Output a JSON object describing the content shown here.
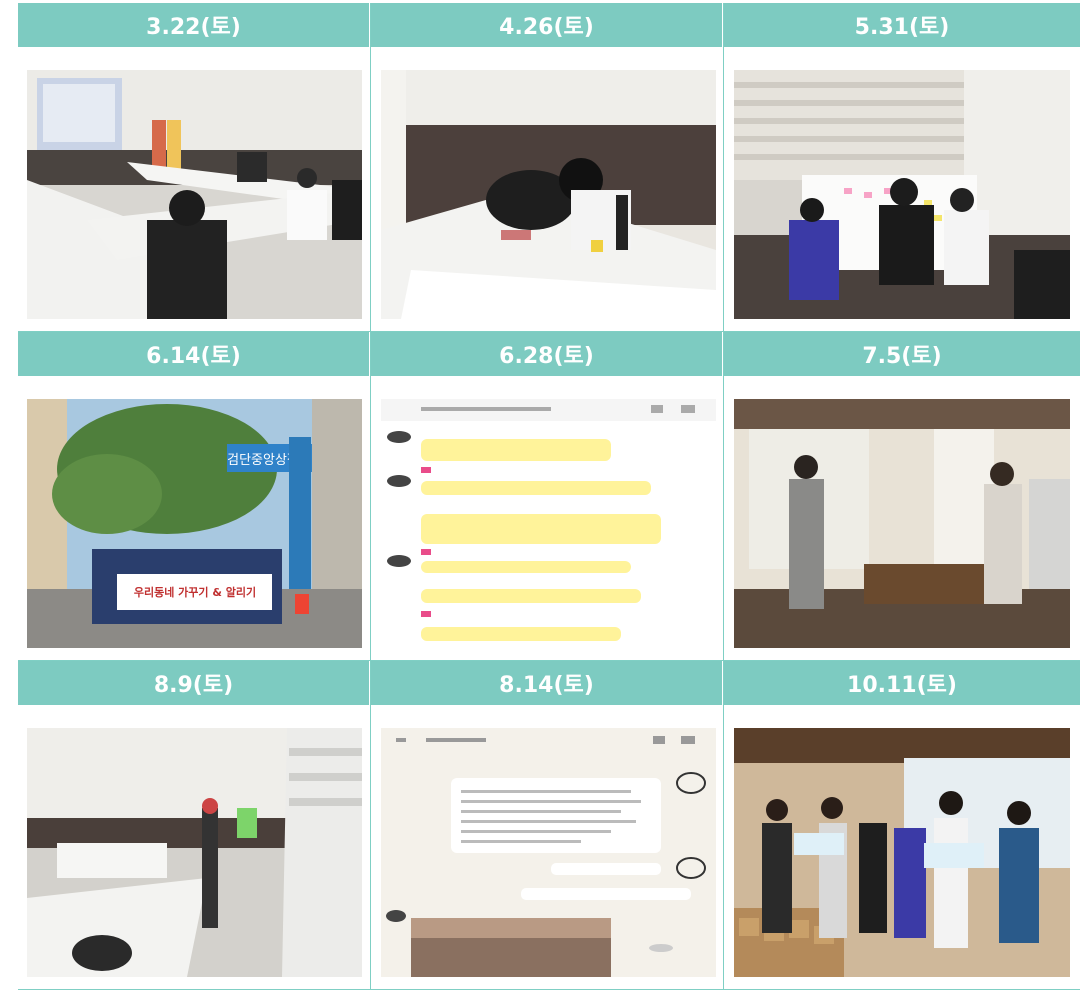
{
  "cells": [
    {
      "date": "3.22(토)",
      "photo": "meeting-room-photo"
    },
    {
      "date": "4.26(토)",
      "photo": "students-writing-photo"
    },
    {
      "date": "5.31(토)",
      "photo": "whiteboard-sticky-notes-photo"
    },
    {
      "date": "6.14(토)",
      "photo": "market-street-group-photo"
    },
    {
      "date": "6.28(토)",
      "photo": "chat-screenshot-photo"
    },
    {
      "date": "7.5(토)",
      "photo": "cafe-interior-photo"
    },
    {
      "date": "8.9(토)",
      "photo": "empty-room-photo"
    },
    {
      "date": "8.14(토)",
      "photo": "chat-screenshot-photo"
    },
    {
      "date": "10.11(토)",
      "photo": "group-with-bread-photo"
    }
  ],
  "banner_text": "우리동네 가꾸기 & 알리기",
  "street_sign_text": "검단중앙상점가",
  "colors": {
    "header": "#7dcbc1",
    "divider": "#7fcfc4"
  }
}
